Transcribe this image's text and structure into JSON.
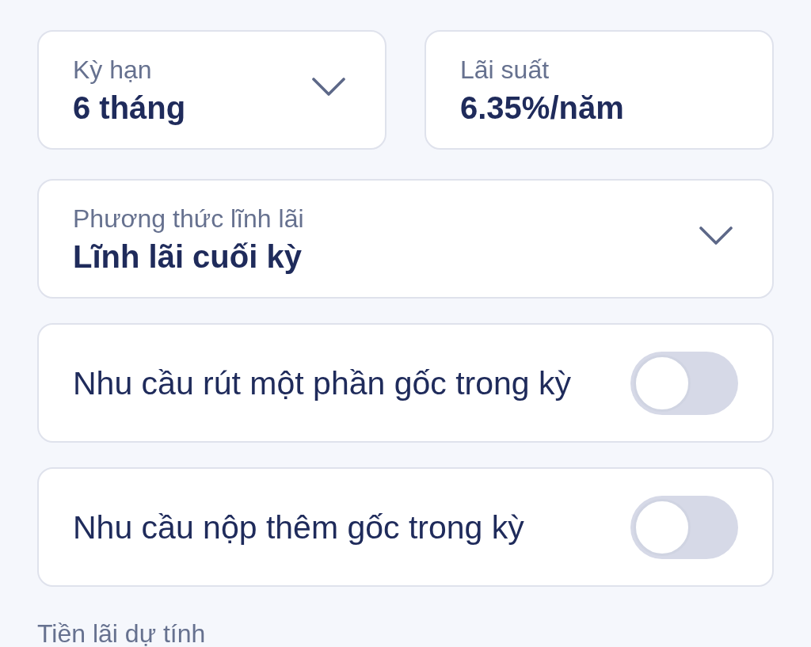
{
  "field_rows": [
    {
      "fields": [
        {
          "kind": "dropdown",
          "label": "Kỳ hạn",
          "value": "6 tháng"
        },
        {
          "kind": "static",
          "label": "Lãi suất",
          "value": "6.35%/năm"
        }
      ]
    },
    {
      "fields": [
        {
          "kind": "dropdown",
          "label": "Phương thức lĩnh lãi",
          "value": "Lĩnh lãi cuối kỳ"
        }
      ]
    }
  ],
  "options": [
    {
      "label": "Nhu cầu rút một phần gốc trong kỳ",
      "on": false
    },
    {
      "label": "Nhu cầu nộp thêm gốc trong kỳ",
      "on": false
    }
  ],
  "section_title": "Tiền lãi dự tính"
}
